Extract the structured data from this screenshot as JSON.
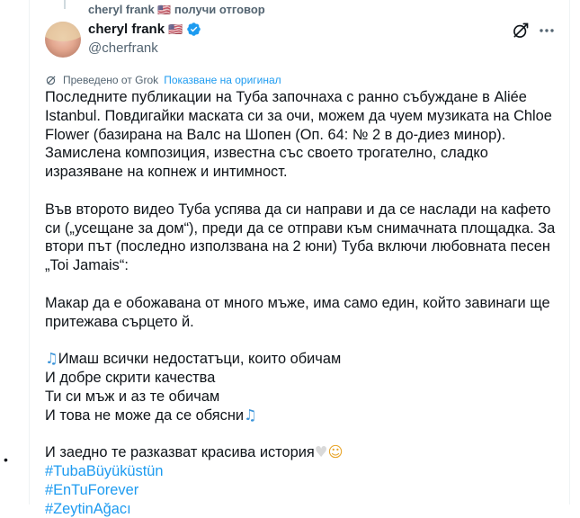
{
  "reply_context": {
    "author": "cheryl frank",
    "flag": "🇺🇸",
    "action": "получи отговор"
  },
  "author": {
    "display_name": "cheryl frank",
    "flag": "🇺🇸",
    "handle": "@cherfrank",
    "verified": true
  },
  "actions": {
    "grok_icon": "grok-icon",
    "more_icon": "more-icon"
  },
  "translation": {
    "label": "Преведено от Grok",
    "link": "Показване на оригинал"
  },
  "tweet": {
    "paragraph1": "Последните публикации на Туба започнаха с ранно събуждане в Aliée Istanbul. Повдигайки маската си за очи, можем да чуем музиката на Chloe Flower (базирана на Валс на Шопен (Оп. 64: № 2 в до-диез минор). Замислена композиция, известна със своето трогателно, сладко изразяване на копнеж и интимност.",
    "paragraph2": "Във второто видео Туба успява да си направи и да се наслади на кафето си („усещане за дом“), преди да се отправи към снимачната площадка. За втори път (последно използвана на 2 юни) Туба включи любовната песен „Toi Jamais“:",
    "paragraph3": "Макар да е обожавана от много мъже, има само един, който завинаги ще притежава сърцето й.",
    "lyric1": "Имаш всички недостатъци, които обичам",
    "lyric2": "И добре скрити качества",
    "lyric3": "Ти си мъж и аз те обичам",
    "lyric4": "И това не може да се обясни",
    "closing": "И заедно те разказват красива история",
    "hashtags": [
      "#TubaBüyüküstün",
      "#EnTuForever",
      "#ZeytinAğacı"
    ]
  },
  "colors": {
    "link": "#1d9bf0",
    "secondary_text": "#536471",
    "primary_text": "#0f1419"
  }
}
